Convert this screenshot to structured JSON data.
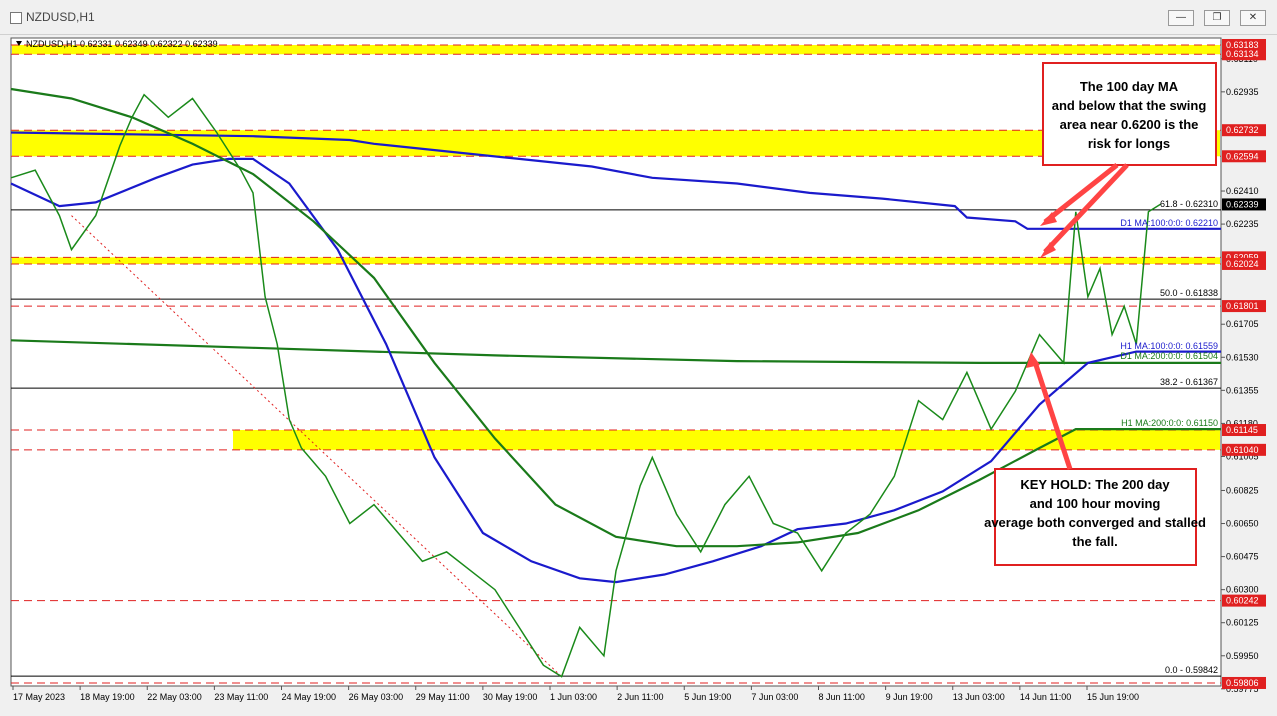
{
  "window": {
    "title": "NZDUSD,H1"
  },
  "chart_data": {
    "type": "line",
    "symbol_header": "NZDUSD,H1  0.62331 0.62349 0.62322 0.62339",
    "x_labels": [
      "17 May 2023",
      "18 May 19:00",
      "22 May 03:00",
      "23 May 11:00",
      "24 May 19:00",
      "26 May 03:00",
      "29 May 11:00",
      "30 May 19:00",
      "1 Jun 03:00",
      "2 Jun 11:00",
      "5 Jun 19:00",
      "7 Jun 03:00",
      "8 Jun 11:00",
      "9 Jun 19:00",
      "13 Jun 03:00",
      "14 Jun 11:00",
      "15 Jun 19:00"
    ],
    "ylim": [
      0.5979,
      0.6322
    ],
    "y_ticks": [
      "0.63110",
      "0.62935",
      "0.62410",
      "0.62235",
      "0.61705",
      "0.61530",
      "0.61355",
      "0.61180",
      "0.61005",
      "0.60825",
      "0.60650",
      "0.60475",
      "0.60300",
      "0.60125",
      "0.59950",
      "0.59775"
    ],
    "price_labels": [
      {
        "text": "0.63183",
        "value": 0.63183,
        "color": "#e02020"
      },
      {
        "text": "0.63134",
        "value": 0.63134,
        "color": "#e02020"
      },
      {
        "text": "0.62732",
        "value": 0.62732,
        "color": "#e02020"
      },
      {
        "text": "0.62594",
        "value": 0.62594,
        "color": "#e02020"
      },
      {
        "text": "0.62339",
        "value": 0.62339,
        "color": "#000000"
      },
      {
        "text": "0.62059",
        "value": 0.62059,
        "color": "#e02020"
      },
      {
        "text": "0.62024",
        "value": 0.62024,
        "color": "#e02020"
      },
      {
        "text": "0.61801",
        "value": 0.61801,
        "color": "#e02020"
      },
      {
        "text": "0.61145",
        "value": 0.61145,
        "color": "#e02020"
      },
      {
        "text": "0.61040",
        "value": 0.6104,
        "color": "#e02020"
      },
      {
        "text": "0.60242",
        "value": 0.60242,
        "color": "#e02020"
      },
      {
        "text": "0.59806",
        "value": 0.59806,
        "color": "#e02020"
      }
    ],
    "yellow_zones": [
      {
        "from": 0.63134,
        "to": 0.63183
      },
      {
        "from": 0.62594,
        "to": 0.62732
      },
      {
        "from": 0.62024,
        "to": 0.62059
      },
      {
        "from": 0.6104,
        "to": 0.61145
      }
    ],
    "red_dashed_levels": [
      0.63183,
      0.63134,
      0.62732,
      0.62594,
      0.62059,
      0.62024,
      0.61801,
      0.61145,
      0.6104,
      0.60242,
      0.59806
    ],
    "fib_levels": [
      {
        "text": "61.8 - 0.62310",
        "value": 0.6231
      },
      {
        "text": "50.0 - 0.61838",
        "value": 0.61838
      },
      {
        "text": "38.2 - 0.61367",
        "value": 0.61367
      },
      {
        "text": "0.0 - 0.59842",
        "value": 0.59842
      }
    ],
    "ma_labels": [
      {
        "text": "D1 MA:100:0:0: 0.62210",
        "value": 0.6221,
        "color": "#1a1acc"
      },
      {
        "text": "H1 MA:100:0:0: 0.61559",
        "value": 0.61559,
        "color": "#1a1acc"
      },
      {
        "text": "D1 MA:200:0:0: 0.61504",
        "value": 0.61504,
        "color": "#1a7a1a"
      },
      {
        "text": "H1 MA:200:0:0: 0.61150",
        "value": 0.6115,
        "color": "#1a7a1a"
      }
    ],
    "series": [
      {
        "name": "D1 MA:100",
        "color": "#1a1acc",
        "values": [
          [
            0,
            0.6272
          ],
          [
            0.1,
            0.6271
          ],
          [
            0.2,
            0.627
          ],
          [
            0.28,
            0.6268
          ],
          [
            0.3,
            0.6266
          ],
          [
            0.36,
            0.6262
          ],
          [
            0.42,
            0.6258
          ],
          [
            0.48,
            0.6254
          ],
          [
            0.53,
            0.6248
          ],
          [
            0.6,
            0.6245
          ],
          [
            0.66,
            0.624
          ],
          [
            0.72,
            0.6237
          ],
          [
            0.78,
            0.6233
          ],
          [
            0.79,
            0.6227
          ],
          [
            0.83,
            0.6225
          ],
          [
            0.84,
            0.6221
          ],
          [
            1.0,
            0.6221
          ]
        ]
      },
      {
        "name": "D1 MA:200",
        "color": "#1a7a1a",
        "values": [
          [
            0,
            0.6162
          ],
          [
            0.2,
            0.6158
          ],
          [
            0.4,
            0.6154
          ],
          [
            0.6,
            0.6151
          ],
          [
            0.8,
            0.615
          ],
          [
            1.0,
            0.615
          ]
        ]
      },
      {
        "name": "H1 MA:100",
        "color": "#1a1acc",
        "values": [
          [
            0,
            0.6245
          ],
          [
            0.04,
            0.6233
          ],
          [
            0.07,
            0.6235
          ],
          [
            0.12,
            0.6248
          ],
          [
            0.15,
            0.6255
          ],
          [
            0.18,
            0.6258
          ],
          [
            0.2,
            0.6258
          ],
          [
            0.23,
            0.6245
          ],
          [
            0.27,
            0.621
          ],
          [
            0.31,
            0.616
          ],
          [
            0.35,
            0.61
          ],
          [
            0.39,
            0.606
          ],
          [
            0.43,
            0.6045
          ],
          [
            0.47,
            0.6036
          ],
          [
            0.5,
            0.6034
          ],
          [
            0.54,
            0.6038
          ],
          [
            0.58,
            0.6045
          ],
          [
            0.62,
            0.6053
          ],
          [
            0.65,
            0.6062
          ],
          [
            0.69,
            0.6065
          ],
          [
            0.73,
            0.6072
          ],
          [
            0.77,
            0.6082
          ],
          [
            0.81,
            0.6098
          ],
          [
            0.85,
            0.6128
          ],
          [
            0.89,
            0.615
          ],
          [
            0.93,
            0.6156
          ],
          [
            1.0,
            0.6156
          ]
        ]
      },
      {
        "name": "H1 MA:200",
        "color": "#1a7a1a",
        "values": [
          [
            0,
            0.6295
          ],
          [
            0.05,
            0.629
          ],
          [
            0.1,
            0.628
          ],
          [
            0.15,
            0.6266
          ],
          [
            0.2,
            0.625
          ],
          [
            0.25,
            0.6225
          ],
          [
            0.3,
            0.6195
          ],
          [
            0.35,
            0.615
          ],
          [
            0.4,
            0.611
          ],
          [
            0.45,
            0.6075
          ],
          [
            0.5,
            0.6058
          ],
          [
            0.55,
            0.6053
          ],
          [
            0.6,
            0.6053
          ],
          [
            0.65,
            0.6055
          ],
          [
            0.7,
            0.606
          ],
          [
            0.75,
            0.6072
          ],
          [
            0.8,
            0.6088
          ],
          [
            0.85,
            0.6105
          ],
          [
            0.88,
            0.6115
          ],
          [
            0.92,
            0.6115
          ],
          [
            1.0,
            0.6115
          ]
        ]
      },
      {
        "name": "Price",
        "color": "#1a8a1a",
        "values": [
          [
            0,
            0.6248
          ],
          [
            0.02,
            0.6252
          ],
          [
            0.04,
            0.6228
          ],
          [
            0.05,
            0.621
          ],
          [
            0.07,
            0.6228
          ],
          [
            0.09,
            0.6265
          ],
          [
            0.1,
            0.628
          ],
          [
            0.11,
            0.6292
          ],
          [
            0.13,
            0.628
          ],
          [
            0.15,
            0.629
          ],
          [
            0.17,
            0.6272
          ],
          [
            0.19,
            0.6252
          ],
          [
            0.2,
            0.624
          ],
          [
            0.21,
            0.6185
          ],
          [
            0.22,
            0.616
          ],
          [
            0.23,
            0.612
          ],
          [
            0.24,
            0.6105
          ],
          [
            0.26,
            0.609
          ],
          [
            0.28,
            0.6065
          ],
          [
            0.3,
            0.6075
          ],
          [
            0.32,
            0.606
          ],
          [
            0.34,
            0.6045
          ],
          [
            0.36,
            0.605
          ],
          [
            0.38,
            0.604
          ],
          [
            0.4,
            0.603
          ],
          [
            0.42,
            0.601
          ],
          [
            0.44,
            0.599
          ],
          [
            0.455,
            0.5984
          ],
          [
            0.47,
            0.601
          ],
          [
            0.49,
            0.5995
          ],
          [
            0.5,
            0.604
          ],
          [
            0.52,
            0.6085
          ],
          [
            0.53,
            0.61
          ],
          [
            0.55,
            0.607
          ],
          [
            0.57,
            0.605
          ],
          [
            0.59,
            0.6075
          ],
          [
            0.61,
            0.609
          ],
          [
            0.63,
            0.6065
          ],
          [
            0.65,
            0.606
          ],
          [
            0.67,
            0.604
          ],
          [
            0.69,
            0.606
          ],
          [
            0.71,
            0.607
          ],
          [
            0.73,
            0.609
          ],
          [
            0.75,
            0.613
          ],
          [
            0.77,
            0.612
          ],
          [
            0.79,
            0.6145
          ],
          [
            0.81,
            0.6115
          ],
          [
            0.83,
            0.6135
          ],
          [
            0.85,
            0.6165
          ],
          [
            0.87,
            0.615
          ],
          [
            0.88,
            0.623
          ],
          [
            0.89,
            0.6185
          ],
          [
            0.9,
            0.62
          ],
          [
            0.91,
            0.6165
          ],
          [
            0.92,
            0.618
          ],
          [
            0.93,
            0.616
          ],
          [
            0.94,
            0.623
          ],
          [
            0.95,
            0.6234
          ]
        ]
      }
    ],
    "annotations": [
      {
        "name": "ma-risk-callout",
        "text": "The 100 day MA and below that the swing area near 0.6200 is the risk for longs"
      },
      {
        "name": "key-hold-callout",
        "text": "KEY HOLD: The 200 day and 100 hour moving average both converged and stalled the fall."
      }
    ],
    "colors": {
      "background": "#ffffff",
      "grid": "#ffffff",
      "zone": "#ffff00",
      "level": "#e02020",
      "callout_border": "#e02020",
      "arrow": "#ff4444",
      "price_up": "#1a8a1a"
    }
  }
}
